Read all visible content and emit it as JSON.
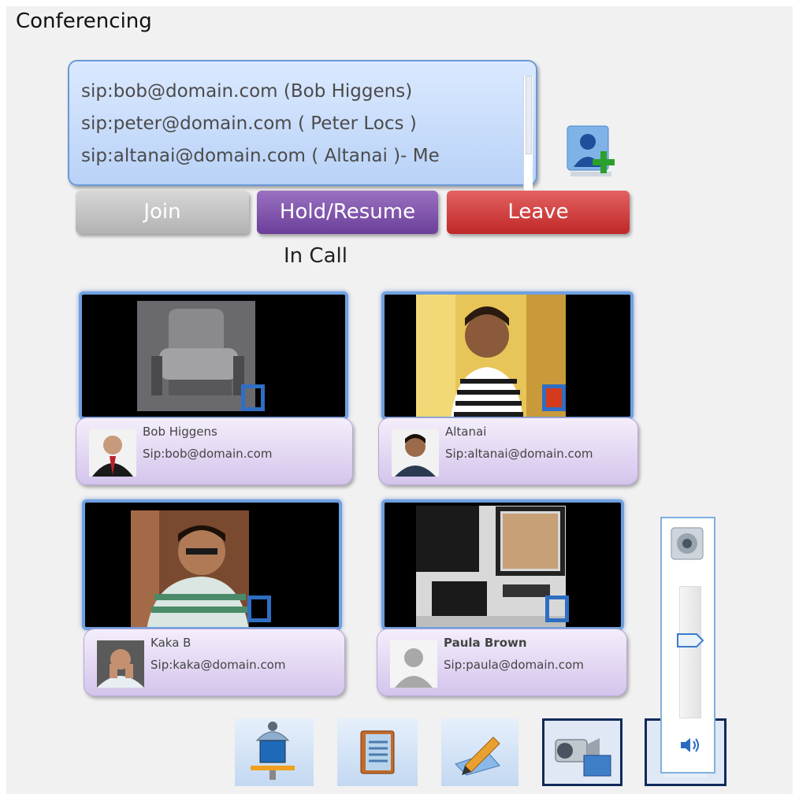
{
  "window": {
    "title": "Conferencing"
  },
  "participant_list": {
    "items": [
      "sip:bob@domain.com (Bob Higgens)",
      "sip:peter@domain.com ( Peter Locs )",
      "sip:altanai@domain.com ( Altanai )- Me"
    ]
  },
  "controls": {
    "join_label": "Join",
    "hold_label": "Hold/Resume",
    "leave_label": "Leave"
  },
  "status": {
    "call_state": "In Call"
  },
  "tiles": [
    {
      "name": "Bob Higgens",
      "sip": "Sip:bob@domain.com"
    },
    {
      "name": "Altanai",
      "sip": "Sip:altanai@domain.com"
    },
    {
      "name": "Kaka  B",
      "sip": "Sip:kaka@domain.com"
    },
    {
      "name": "Paula Brown",
      "sip": "Sip:paula@domain.com"
    }
  ],
  "colors": {
    "join": "#c4c4c4",
    "hold": "#7b4fad",
    "leave": "#d03a3a",
    "tile_border": "#6ea0e0",
    "card": "#e2d6f3"
  },
  "icons": {
    "add_participant": "add-user-icon",
    "toolbar": [
      "network-share-icon",
      "address-book-icon",
      "whiteboard-pen-icon",
      "video-camera-icon",
      "speaker-volume-icon"
    ],
    "volume_speaker": "speaker-icon",
    "volume_level": "volume-level-icon"
  },
  "volume": {
    "level": 0.6
  }
}
